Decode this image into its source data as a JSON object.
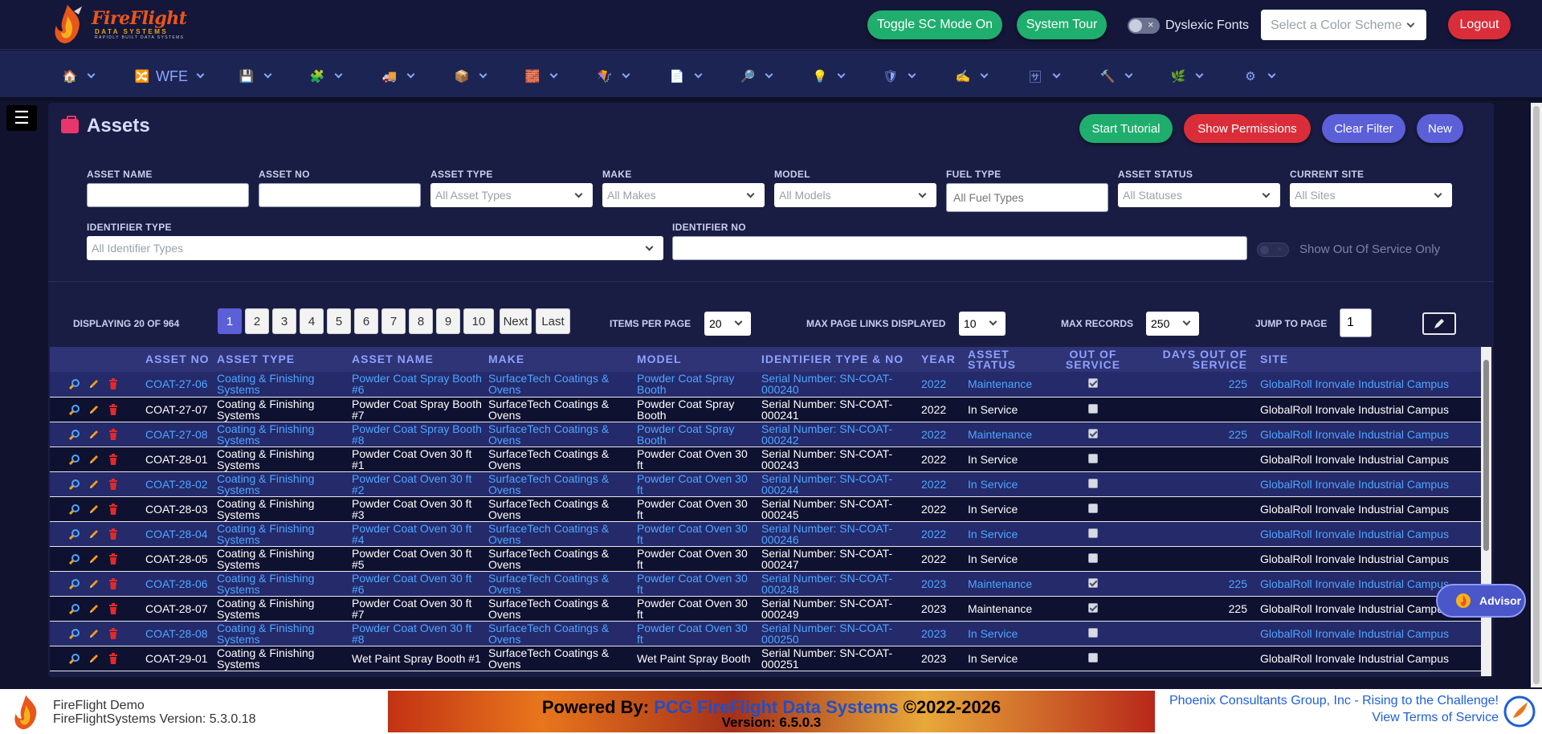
{
  "header": {
    "brand": "FireFlight",
    "brand_sub": "DATA SYSTEMS",
    "brand_tagline": "RAPIDLY BUILT DATA SYSTEMS",
    "toggle_sc": "Toggle SC Mode On",
    "system_tour": "System Tour",
    "dyslexic_label": "Dyslexic Fonts",
    "color_scheme_placeholder": "Select a Color Scheme",
    "logout": "Logout"
  },
  "nav": {
    "wfe_label": "WFE"
  },
  "page": {
    "title": "Assets",
    "start_tutorial": "Start Tutorial",
    "show_permissions": "Show Permissions",
    "clear_filter": "Clear Filter",
    "new": "New"
  },
  "filters": {
    "asset_name": "ASSET NAME",
    "asset_no": "ASSET NO",
    "asset_type": "ASSET TYPE",
    "asset_type_ph": "All Asset Types",
    "make": "MAKE",
    "make_ph": "All Makes",
    "model": "MODEL",
    "model_ph": "All Models",
    "fuel_type": "FUEL TYPE",
    "fuel_type_ph": "All Fuel Types",
    "asset_status": "ASSET STATUS",
    "asset_status_ph": "All Statuses",
    "current_site": "CURRENT SITE",
    "current_site_ph": "All Sites",
    "identifier_type": "IDENTIFIER TYPE",
    "identifier_type_ph": "All Identifier Types",
    "identifier_no": "IDENTIFIER NO",
    "out_of_service_only": "Show Out Of Service Only"
  },
  "pagination": {
    "displaying": "DISPLAYING 20 OF 964",
    "pages": [
      "1",
      "2",
      "3",
      "4",
      "5",
      "6",
      "7",
      "8",
      "9",
      "10"
    ],
    "next": "Next",
    "last": "Last",
    "items_per_page_label": "ITEMS PER PAGE",
    "items_per_page": "20",
    "max_links_label": "MAX PAGE LINKS DISPLAYED",
    "max_links": "10",
    "max_records_label": "MAX RECORDS",
    "max_records": "250",
    "jump_label": "JUMP TO PAGE",
    "jump_value": "1"
  },
  "table": {
    "headers": [
      "",
      "ASSET NO",
      "ASSET TYPE",
      "ASSET NAME",
      "MAKE",
      "MODEL",
      "IDENTIFIER TYPE & NO",
      "YEAR",
      "ASSET STATUS",
      "OUT OF SERVICE",
      "DAYS OUT OF SERVICE",
      "SITE"
    ],
    "rows": [
      {
        "no": "COAT-27-06",
        "type": "Coating & Finishing Systems",
        "name": "Powder Coat Spray Booth #6",
        "make": "SurfaceTech Coatings & Ovens",
        "model": "Powder Coat Spray Booth",
        "ident": "Serial Number: SN-COAT-000240",
        "year": "2022",
        "status": "Maintenance",
        "oos": true,
        "days": "225",
        "site": "GlobalRoll Ironvale Industrial Campus"
      },
      {
        "no": "COAT-27-07",
        "type": "Coating & Finishing Systems",
        "name": "Powder Coat Spray Booth #7",
        "make": "SurfaceTech Coatings & Ovens",
        "model": "Powder Coat Spray Booth",
        "ident": "Serial Number: SN-COAT-000241",
        "year": "2022",
        "status": "In Service",
        "oos": false,
        "days": "",
        "site": "GlobalRoll Ironvale Industrial Campus"
      },
      {
        "no": "COAT-27-08",
        "type": "Coating & Finishing Systems",
        "name": "Powder Coat Spray Booth #8",
        "make": "SurfaceTech Coatings & Ovens",
        "model": "Powder Coat Spray Booth",
        "ident": "Serial Number: SN-COAT-000242",
        "year": "2022",
        "status": "Maintenance",
        "oos": true,
        "days": "225",
        "site": "GlobalRoll Ironvale Industrial Campus"
      },
      {
        "no": "COAT-28-01",
        "type": "Coating & Finishing Systems",
        "name": "Powder Coat Oven 30 ft #1",
        "make": "SurfaceTech Coatings & Ovens",
        "model": "Powder Coat Oven 30 ft",
        "ident": "Serial Number: SN-COAT-000243",
        "year": "2022",
        "status": "In Service",
        "oos": false,
        "days": "",
        "site": "GlobalRoll Ironvale Industrial Campus"
      },
      {
        "no": "COAT-28-02",
        "type": "Coating & Finishing Systems",
        "name": "Powder Coat Oven 30 ft #2",
        "make": "SurfaceTech Coatings & Ovens",
        "model": "Powder Coat Oven 30 ft",
        "ident": "Serial Number: SN-COAT-000244",
        "year": "2022",
        "status": "In Service",
        "oos": false,
        "days": "",
        "site": "GlobalRoll Ironvale Industrial Campus"
      },
      {
        "no": "COAT-28-03",
        "type": "Coating & Finishing Systems",
        "name": "Powder Coat Oven 30 ft #3",
        "make": "SurfaceTech Coatings & Ovens",
        "model": "Powder Coat Oven 30 ft",
        "ident": "Serial Number: SN-COAT-000245",
        "year": "2022",
        "status": "In Service",
        "oos": false,
        "days": "",
        "site": "GlobalRoll Ironvale Industrial Campus"
      },
      {
        "no": "COAT-28-04",
        "type": "Coating & Finishing Systems",
        "name": "Powder Coat Oven 30 ft #4",
        "make": "SurfaceTech Coatings & Ovens",
        "model": "Powder Coat Oven 30 ft",
        "ident": "Serial Number: SN-COAT-000246",
        "year": "2022",
        "status": "In Service",
        "oos": false,
        "days": "",
        "site": "GlobalRoll Ironvale Industrial Campus"
      },
      {
        "no": "COAT-28-05",
        "type": "Coating & Finishing Systems",
        "name": "Powder Coat Oven 30 ft #5",
        "make": "SurfaceTech Coatings & Ovens",
        "model": "Powder Coat Oven 30 ft",
        "ident": "Serial Number: SN-COAT-000247",
        "year": "2022",
        "status": "In Service",
        "oos": false,
        "days": "",
        "site": "GlobalRoll Ironvale Industrial Campus"
      },
      {
        "no": "COAT-28-06",
        "type": "Coating & Finishing Systems",
        "name": "Powder Coat Oven 30 ft #6",
        "make": "SurfaceTech Coatings & Ovens",
        "model": "Powder Coat Oven 30 ft",
        "ident": "Serial Number: SN-COAT-000248",
        "year": "2023",
        "status": "Maintenance",
        "oos": true,
        "days": "225",
        "site": "GlobalRoll Ironvale Industrial Campus"
      },
      {
        "no": "COAT-28-07",
        "type": "Coating & Finishing Systems",
        "name": "Powder Coat Oven 30 ft #7",
        "make": "SurfaceTech Coatings & Ovens",
        "model": "Powder Coat Oven 30 ft",
        "ident": "Serial Number: SN-COAT-000249",
        "year": "2023",
        "status": "Maintenance",
        "oos": true,
        "days": "225",
        "site": "GlobalRoll Ironvale Industrial Campus"
      },
      {
        "no": "COAT-28-08",
        "type": "Coating & Finishing Systems",
        "name": "Powder Coat Oven 30 ft #8",
        "make": "SurfaceTech Coatings & Ovens",
        "model": "Powder Coat Oven 30 ft",
        "ident": "Serial Number: SN-COAT-000250",
        "year": "2023",
        "status": "In Service",
        "oos": false,
        "days": "",
        "site": "GlobalRoll Ironvale Industrial Campus"
      },
      {
        "no": "COAT-29-01",
        "type": "Coating & Finishing Systems",
        "name": "Wet Paint Spray Booth #1",
        "make": "SurfaceTech Coatings & Ovens",
        "model": "Wet Paint Spray Booth",
        "ident": "Serial Number: SN-COAT-000251",
        "year": "2023",
        "status": "In Service",
        "oos": false,
        "days": "",
        "site": "GlobalRoll Ironvale Industrial Campus"
      }
    ]
  },
  "advisor": "Advisor",
  "footer": {
    "demo": "FireFlight Demo",
    "version_left": "FireFlightSystems Version: 5.3.0.18",
    "powered_by": "Powered By: ",
    "powered_name": "PCG FireFlight Data Systems",
    "powered_years": " ©2022-2026",
    "version_center": "Version: 6.5.0.3",
    "company": "Phoenix Consultants Group, Inc - Rising to the Challenge!",
    "terms": "View Terms of Service"
  },
  "colors": {
    "accent": "#5b5fd8",
    "green": "#1fae6e",
    "red": "#d92e3a",
    "link": "#4fa6ff"
  }
}
